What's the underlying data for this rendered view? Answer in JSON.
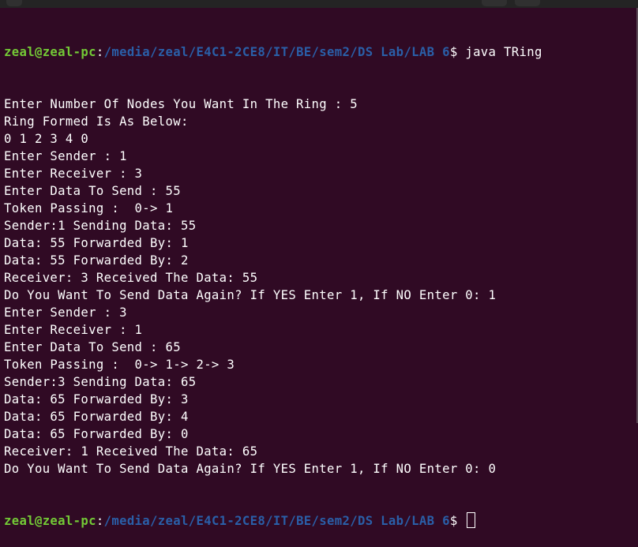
{
  "window": {
    "title_bar": ""
  },
  "prompt": {
    "user_host": "zeal@zeal-pc",
    "separator": ":",
    "path": "/media/zeal/E4C1-2CE8/IT/BE/sem2/DS Lab/LAB 6",
    "symbol": "$ ",
    "command": "java TRing"
  },
  "output": [
    "Enter Number Of Nodes You Want In The Ring : 5",
    "Ring Formed Is As Below:",
    "0 1 2 3 4 0",
    "Enter Sender : 1",
    "Enter Receiver : 3",
    "Enter Data To Send : 55",
    "Token Passing :  0-> 1",
    "Sender:1 Sending Data: 55",
    "Data: 55 Forwarded By: 1",
    "Data: 55 Forwarded By: 2",
    "Receiver: 3 Received The Data: 55",
    "Do You Want To Send Data Again? If YES Enter 1, If NO Enter 0: 1",
    "Enter Sender : 3",
    "Enter Receiver : 1",
    "Enter Data To Send : 65",
    "Token Passing :  0-> 1-> 2-> 3",
    "Sender:3 Sending Data: 65",
    "Data: 65 Forwarded By: 3",
    "Data: 65 Forwarded By: 4",
    "Data: 65 Forwarded By: 0",
    "Receiver: 1 Received The Data: 65",
    "Do You Want To Send Data Again? If YES Enter 1, If NO Enter 0: 0"
  ],
  "colors": {
    "background": "#300a24",
    "user_host": "#73c936",
    "path": "#2a5fa8",
    "text": "#ffffff"
  }
}
